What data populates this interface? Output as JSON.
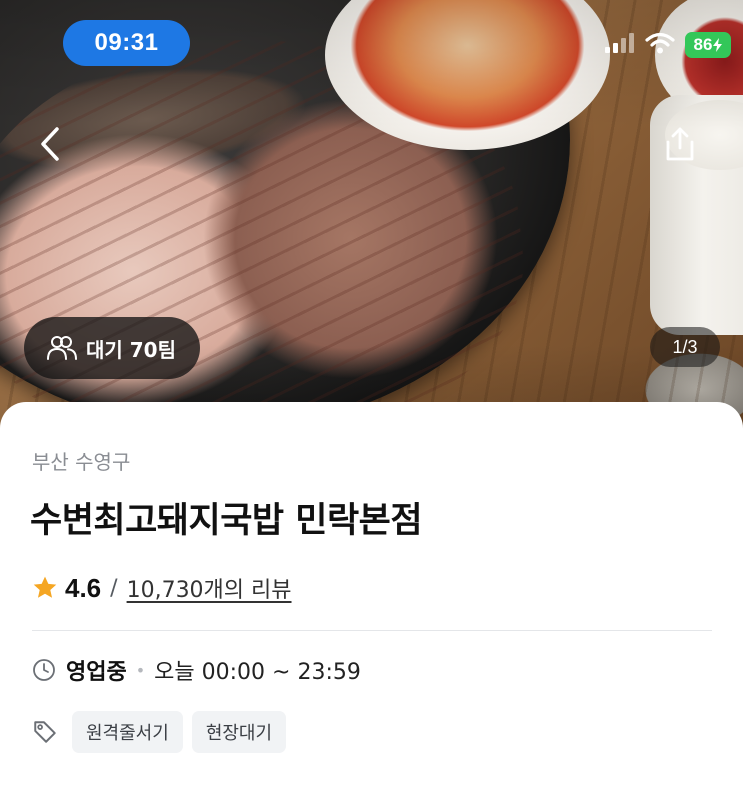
{
  "status_bar": {
    "time": "09:31",
    "battery": "86"
  },
  "hero": {
    "wait_badge": "대기 70팀",
    "photo_counter": "1/3"
  },
  "store": {
    "region": "부산 수영구",
    "name": "수변최고돼지국밥 민락본점",
    "rating": "4.6",
    "rating_separator": "/",
    "review_link": "10,730개의 리뷰",
    "open_status": "영업중",
    "hours_separator": "•",
    "hours": "오늘 00:00 ~ 23:59",
    "tags": [
      "원격줄서기",
      "현장대기"
    ]
  },
  "colors": {
    "time_pill": "#1e78e4",
    "battery": "#33c759",
    "star": "#f5a623"
  }
}
